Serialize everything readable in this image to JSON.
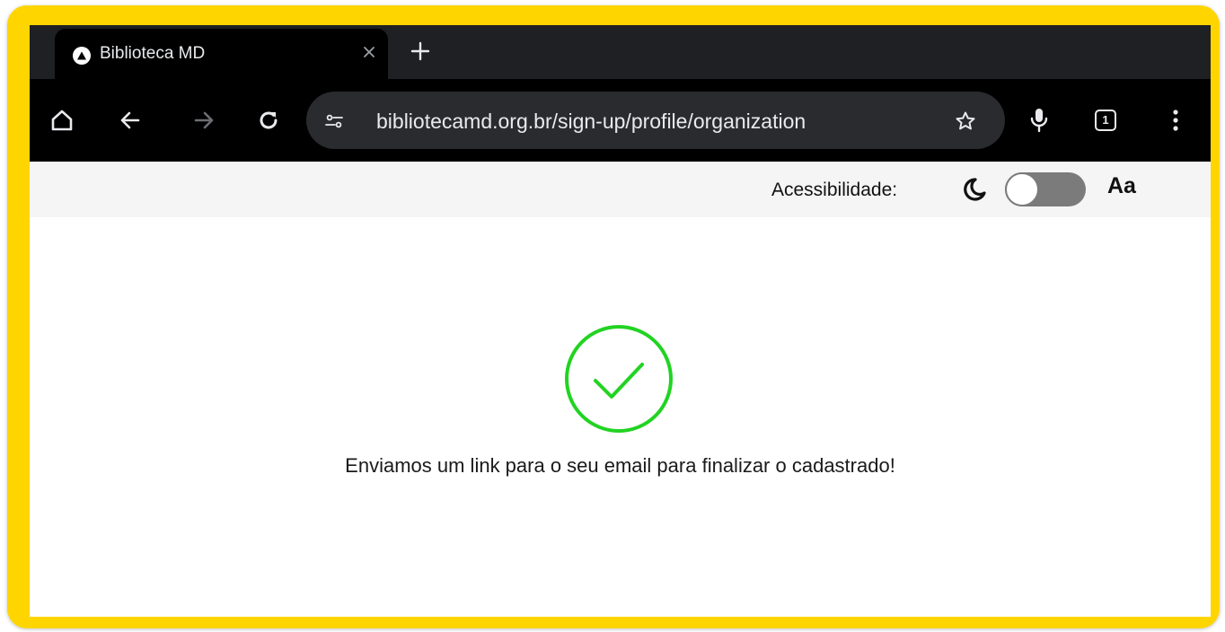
{
  "browser": {
    "tab": {
      "title": "Biblioteca MD",
      "favicon": "triangle-logo-icon",
      "close_icon": "close-icon"
    },
    "new_tab_icon": "plus-icon",
    "toolbar": {
      "home_icon": "home-icon",
      "back_icon": "arrow-left-icon",
      "forward_icon": "arrow-right-icon",
      "reload_icon": "reload-icon",
      "site_info_icon": "tune-icon",
      "url": "bibliotecamd.org.br/sign-up/profile/organization",
      "bookmark_icon": "star-icon",
      "mic_icon": "microphone-icon",
      "tab_count": "1",
      "menu_icon": "kebab-menu-icon"
    }
  },
  "accessibility": {
    "label": "Acessibilidade:",
    "dark_mode_icon": "moon-icon",
    "dark_mode_enabled": false,
    "font_size_label": "Aa"
  },
  "main": {
    "success_icon": "check-circle-icon",
    "message": "Enviamos um link para o seu email para finalizar o cadastrado!"
  },
  "colors": {
    "frame": "#ffd500",
    "browser_chrome": "#000000",
    "tabstrip": "#1f2023",
    "omnibox": "#2a2b2e",
    "success": "#22d322",
    "toggle_track": "#7b7b7b"
  }
}
